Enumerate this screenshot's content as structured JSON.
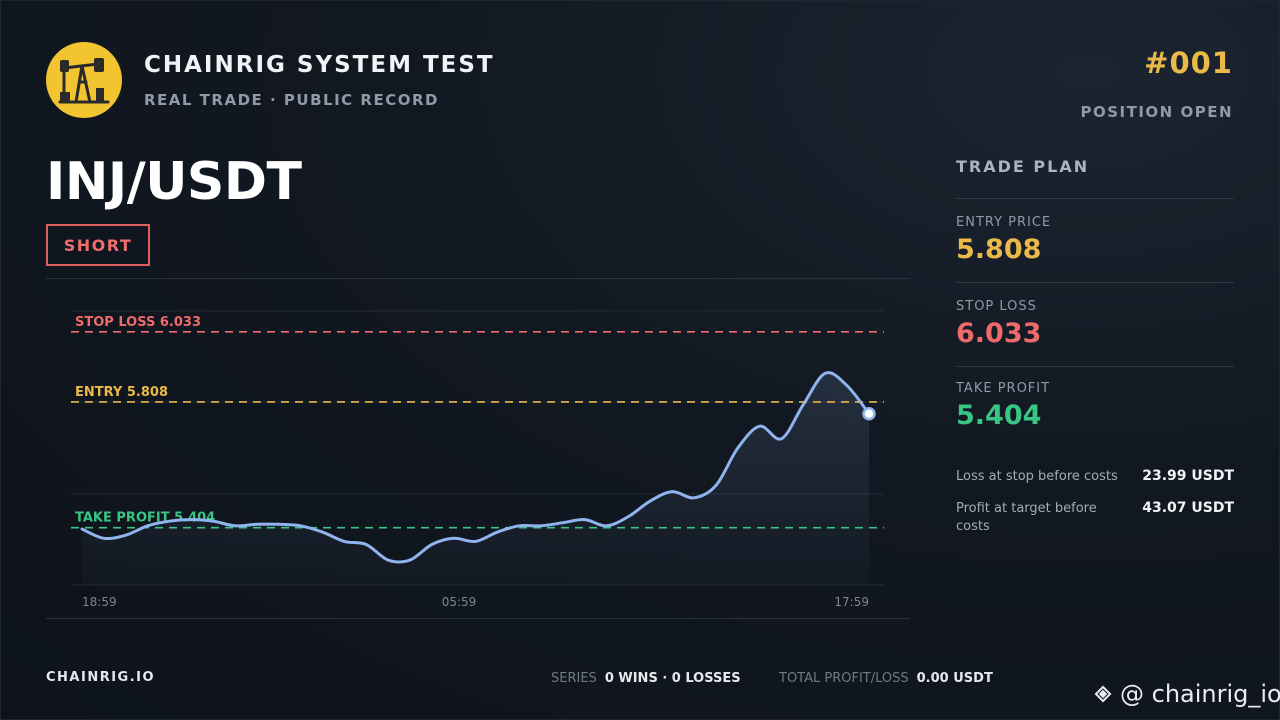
{
  "brand": {
    "title": "CHAINRIG SYSTEM TEST",
    "subtitle": "REAL TRADE · PUBLIC RECORD",
    "logo_icon": "oil-pump-jack-icon",
    "logo_color": "#f2c530"
  },
  "trade": {
    "id": "#001",
    "status": "POSITION OPEN",
    "pair": "INJ/USDT",
    "side": "SHORT"
  },
  "plan": {
    "title": "TRADE PLAN",
    "entry_label": "ENTRY PRICE",
    "entry_value": "5.808",
    "stop_label": "STOP LOSS",
    "stop_value": "6.033",
    "tp_label": "TAKE PROFIT",
    "tp_value": "5.404",
    "loss_label": "Loss at stop before costs",
    "loss_value": "23.99 USDT",
    "profit_label": "Profit at target before costs",
    "profit_value": "43.07 USDT"
  },
  "footer": {
    "site": "CHAINRIG.IO",
    "series_label": "SERIES",
    "series_value": "0 WINS · 0 LOSSES",
    "total_label": "TOTAL PROFIT/LOSS",
    "total_value": "0.00 USDT"
  },
  "watermark": {
    "text": "@ chainrig_io",
    "icon": "binance-diamond-icon"
  },
  "colors": {
    "accent_gold": "#e9b949",
    "stop_red": "#ef6a6b",
    "profit_green": "#39c685",
    "price_line": "#8fb4ee"
  },
  "chart_data": {
    "type": "line",
    "x_tick_labels": [
      "18:59",
      "05:59",
      "17:59"
    ],
    "levels": [
      {
        "label": "STOP LOSS 6.033",
        "value": 6.033,
        "color": "#ef6a6b"
      },
      {
        "label": "ENTRY 5.808",
        "value": 5.808,
        "color": "#e9b949"
      },
      {
        "label": "TAKE PROFIT 5.404",
        "value": 5.404,
        "color": "#39c685"
      }
    ],
    "ylim": [
      5.22,
      6.1
    ],
    "grid": true,
    "series": [
      {
        "values": [
          5.4,
          5.37,
          5.38,
          5.41,
          5.425,
          5.43,
          5.425,
          5.41,
          5.415,
          5.415,
          5.41,
          5.39,
          5.36,
          5.35,
          5.3,
          5.3,
          5.35,
          5.37,
          5.36,
          5.39,
          5.41,
          5.41,
          5.42,
          5.43,
          5.41,
          5.44,
          5.49,
          5.52,
          5.5,
          5.54,
          5.66,
          5.73,
          5.69,
          5.8,
          5.9,
          5.86,
          5.77
        ]
      }
    ]
  }
}
